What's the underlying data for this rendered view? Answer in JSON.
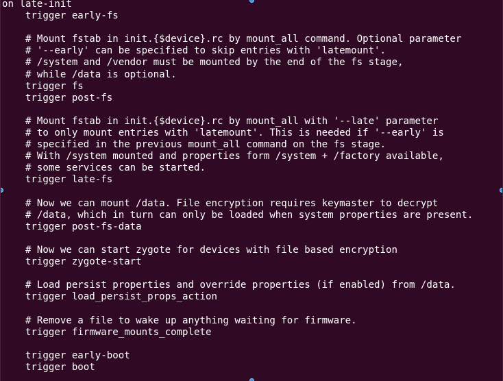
{
  "terminal": {
    "background": "#300a24",
    "foreground": "#ffffff",
    "lines": [
      "on late-init",
      "    trigger early-fs",
      "",
      "    # Mount fstab in init.{$device}.rc by mount_all command. Optional parameter",
      "    # '--early' can be specified to skip entries with 'latemount'.",
      "    # /system and /vendor must be mounted by the end of the fs stage,",
      "    # while /data is optional.",
      "    trigger fs",
      "    trigger post-fs",
      "",
      "    # Mount fstab in init.{$device}.rc by mount_all with '--late' parameter",
      "    # to only mount entries with 'latemount'. This is needed if '--early' is",
      "    # specified in the previous mount_all command on the fs stage.",
      "    # With /system mounted and properties form /system + /factory available,",
      "    # some services can be started.",
      "    trigger late-fs",
      "",
      "    # Now we can mount /data. File encryption requires keymaster to decrypt",
      "    # /data, which in turn can only be loaded when system properties are present.",
      "    trigger post-fs-data",
      "",
      "    # Now we can start zygote for devices with file based encryption",
      "    trigger zygote-start",
      "",
      "    # Load persist properties and override properties (if enabled) from /data.",
      "    trigger load_persist_props_action",
      "",
      "    # Remove a file to wake up anything waiting for firmware.",
      "    trigger firmware_mounts_complete",
      "",
      "    trigger early-boot",
      "    trigger boot"
    ]
  },
  "selection_handle_color": "#3d8fe0"
}
